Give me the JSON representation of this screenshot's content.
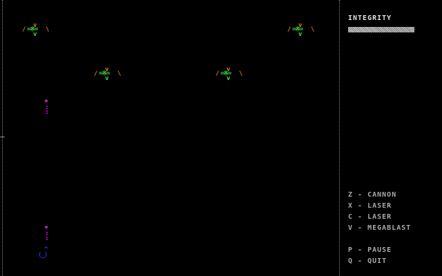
{
  "hud": {
    "integrity_label": "INTEGRITY",
    "integrity_level": 1.0,
    "controls": [
      {
        "key": "Z",
        "action": "CANNON"
      },
      {
        "key": "X",
        "action": "LASER"
      },
      {
        "key": "C",
        "action": "LASER"
      },
      {
        "key": "V",
        "action": "MEGABLAST"
      }
    ],
    "system": [
      {
        "key": "P",
        "action": "PAUSE"
      },
      {
        "key": "Q",
        "action": "QUIT"
      }
    ]
  },
  "colors": {
    "background": "#000000",
    "border": "#8a8a8a",
    "enemy_wing": "#e07a1a",
    "enemy_body": "#3ee03e",
    "missile": "#ff33ff",
    "player": "#3030d8",
    "hud_text": "#bfbfbf"
  },
  "sprites": {
    "enemy": {
      "top": "v",
      "left_wing": "/",
      "body": "=※=",
      "right_wing": "\\",
      "tail": "v"
    },
    "missile": {
      "head": "*"
    },
    "player": {
      "nose": "^",
      "body": "(_)"
    }
  },
  "entities": {
    "enemy_count": 4,
    "missile_count": 2
  }
}
